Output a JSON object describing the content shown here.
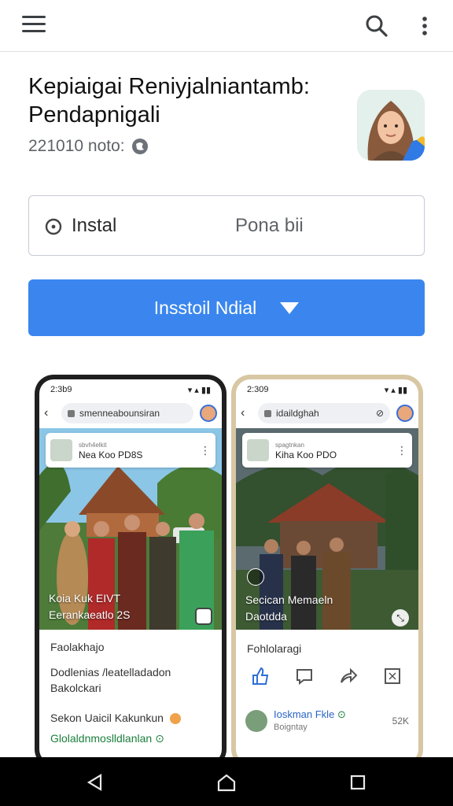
{
  "appbar": {
    "menu_icon": "hamburger-menu-icon",
    "search_icon": "search-icon",
    "more_icon": "more-vert-icon"
  },
  "app": {
    "title_line1": "Kepiaigai Reniyjalniantamb:",
    "title_line2": "Pendapnigali",
    "meta": "221010 noto:",
    "accent": "#3a86ee"
  },
  "info_box": {
    "label_left": "Instal",
    "label_right": "Pona bii"
  },
  "install_button": {
    "label": "Insstoil Ndial"
  },
  "phone1": {
    "status_time": "2:3b9",
    "url": "smenneabounsiran",
    "post_title": "Nea Koo PD8S",
    "post_sub": "sbvh4elkit",
    "caption_line1": "Koia Kuk       EIVT",
    "caption_line2": "Eerankaeatlo  2S",
    "section_label": "Faolakhajo",
    "desc_line1": "Dodlenias /leatelladadon",
    "desc_line2": "Bakolckari",
    "footer1": "Sekon Uaicil Kakunkun",
    "footer2": "Glolaldnmoslldlanlan"
  },
  "phone2": {
    "status_time": "2:309",
    "url": "idaildghah",
    "post_title": "Kiha Koo PDO",
    "post_sub": "spagtnkan",
    "caption_line1": "Secican Memaeln",
    "caption_line2": "Daotdda",
    "section_label": "Fohlolaragi",
    "comment_name": "Ioskman Fkle",
    "comment_sub": "Boigntay",
    "comment_count": "52K"
  }
}
